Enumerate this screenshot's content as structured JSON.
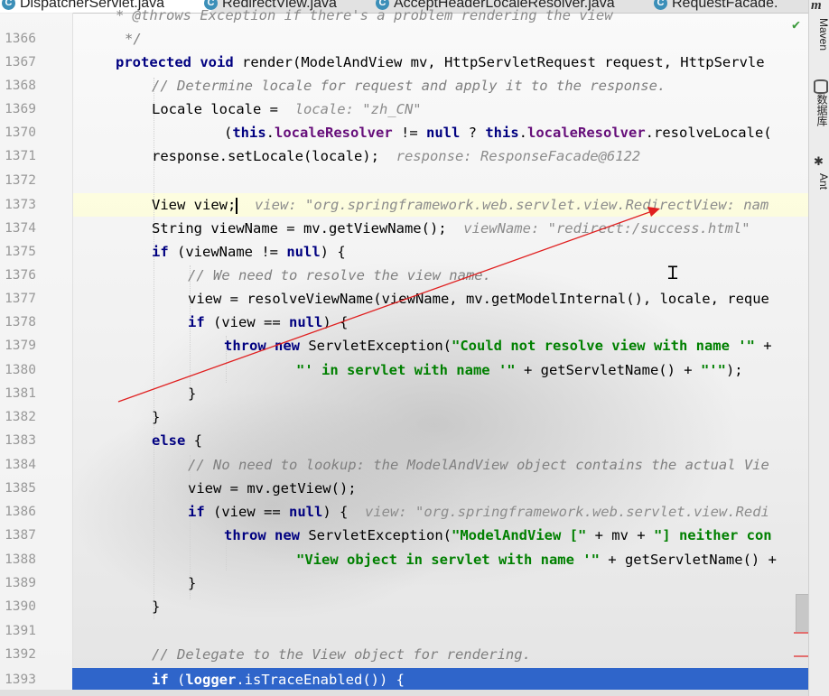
{
  "tabs": [
    {
      "label": "DispatcherServlet.java",
      "icon": "C",
      "active": true
    },
    {
      "label": "RedirectView.java",
      "icon": "C",
      "active": false
    },
    {
      "label": "AcceptHeaderLocaleResolver.java",
      "icon": "C",
      "active": false
    },
    {
      "label": "RequestFacade.",
      "icon": "C",
      "active": false
    }
  ],
  "right_toolbar": {
    "maven": "Maven",
    "database": "数据库",
    "ant": "Ant",
    "top_glyph": "m"
  },
  "top_partial_line": "* @throws Exception if there's a problem rendering the view",
  "lines": [
    {
      "num": "1366",
      "text": "*/"
    },
    {
      "num": "1367",
      "text": "protected void render(ModelAndView mv, HttpServletRequest request, HttpServle"
    },
    {
      "num": "1368",
      "text": "// Determine locale for request and apply it to the response."
    },
    {
      "num": "1369",
      "text": "Locale locale = ",
      "hint": "locale: \"zh_CN\""
    },
    {
      "num": "1370",
      "text": "(this.localeResolver != null ? this.localeResolver.resolveLocale("
    },
    {
      "num": "1371",
      "text": "response.setLocale(locale);",
      "hint": "response: ResponseFacade@6122"
    },
    {
      "num": "1372",
      "text": ""
    },
    {
      "num": "1373",
      "text": "View view;",
      "hint": "view: \"org.springframework.web.servlet.view.RedirectView: nam"
    },
    {
      "num": "1374",
      "text": "String viewName = mv.getViewName();",
      "hint": "viewName: \"redirect:/success.html\""
    },
    {
      "num": "1375",
      "text": "if (viewName != null) {"
    },
    {
      "num": "1376",
      "text": "// We need to resolve the view name."
    },
    {
      "num": "1377",
      "text": "view = resolveViewName(viewName, mv.getModelInternal(), locale, reque"
    },
    {
      "num": "1378",
      "text": "if (view == null) {"
    },
    {
      "num": "1379",
      "text": "throw new ServletException(\"Could not resolve view with name '\" +"
    },
    {
      "num": "1380",
      "text": "\"' in servlet with name '\" + getServletName() + \"'\");"
    },
    {
      "num": "1381",
      "text": "}"
    },
    {
      "num": "1382",
      "text": "}"
    },
    {
      "num": "1383",
      "text": "else {"
    },
    {
      "num": "1384",
      "text": "// No need to lookup: the ModelAndView object contains the actual Vie"
    },
    {
      "num": "1385",
      "text": "view = mv.getView();"
    },
    {
      "num": "1386",
      "text": "if (view == null) {",
      "hint": "view: \"org.springframework.web.servlet.view.Redi"
    },
    {
      "num": "1387",
      "text": "throw new ServletException(\"ModelAndView [\" + mv + \"] neither con"
    },
    {
      "num": "1388",
      "text": "\"View object in servlet with name '\" + getServletName() +"
    },
    {
      "num": "1389",
      "text": "}"
    },
    {
      "num": "1390",
      "text": "}"
    },
    {
      "num": "1391",
      "text": ""
    },
    {
      "num": "1392",
      "text": "// Delegate to the View object for rendering."
    },
    {
      "num": "1393",
      "text": "if (logger.isTraceEnabled()) {"
    }
  ],
  "colors": {
    "keyword": "#000080",
    "comment": "#808080",
    "string": "#008000",
    "field": "#660e7a",
    "selection": "#2f65ca",
    "arrow": "#e02020"
  }
}
